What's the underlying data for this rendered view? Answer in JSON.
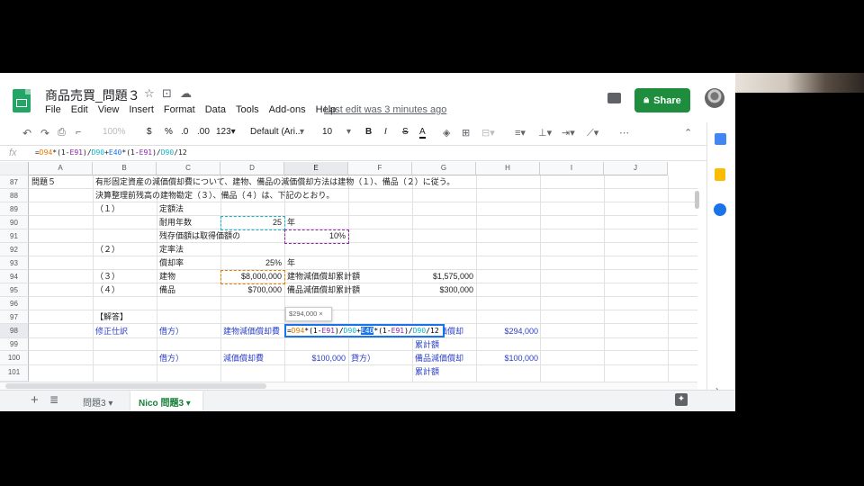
{
  "doc": {
    "title": "商品売買_問題３",
    "last_edit": "Last edit was 3 minutes ago",
    "share_label": "Share"
  },
  "menu": [
    "File",
    "Edit",
    "View",
    "Insert",
    "Format",
    "Data",
    "Tools",
    "Add-ons",
    "Help"
  ],
  "toolbar": {
    "zoom": "100%",
    "currency": "$",
    "percent": "%",
    "dec_less": ".0",
    "dec_more": ".00",
    "more_formats": "123▾",
    "font": "Default (Ari...",
    "font_size": "10",
    "bold": "B",
    "italic": "I",
    "strike": "S",
    "text_color": "A"
  },
  "formula_bar": {
    "fx": "fx",
    "formula_parts": [
      "=",
      "D94",
      "*(1-",
      "E91",
      ")/",
      "D90",
      "+",
      "E40",
      "*(1-",
      "E91",
      ")/",
      "D90",
      "/12"
    ]
  },
  "columns": [
    "A",
    "B",
    "C",
    "D",
    "E",
    "F",
    "G",
    "H",
    "I",
    "J"
  ],
  "row_numbers": [
    "87",
    "88",
    "89",
    "90",
    "91",
    "92",
    "93",
    "94",
    "95",
    "96",
    "97",
    "98",
    "99",
    "100",
    "101"
  ],
  "cells": {
    "a87": "問題５",
    "b87": "有形固定資産の減価償却費について、建物、備品の減価償却方法は建物（１）、備品（２）に従う。",
    "b88": "決算整理前残高の建物勘定（３）、備品（４）は、下記のとおり。",
    "b89": "（１）",
    "c89": "定額法",
    "c90": "耐用年数",
    "d90": "25",
    "e90": "年",
    "c91": "残存価額は取得価額の",
    "e91": "10%",
    "b92": "（２）",
    "c92": "定率法",
    "c93": "償却率",
    "d93": "25%",
    "e93": "年",
    "b94": "（３）",
    "c94": "建物",
    "d94": "$8,000,000",
    "e94": "建物減価償却累計額",
    "g94": "$1,575,000",
    "b95": "（４）",
    "c95": "備品",
    "d95": "$700,000",
    "e95": "備品減価償却累計額",
    "g95": "$300,000",
    "b97": "【解答】",
    "b98": "修正仕訳",
    "c98": "借方）",
    "d98": "建物減価償却費",
    "g98": "建物減価償却",
    "h98": "$294,000",
    "g99": "累計額",
    "c100": "借方）",
    "d100": "減価償却費",
    "e100": "$100,000",
    "f100": "貸方）",
    "g100": "備品減価償却",
    "h100": "$100,000",
    "g101": "累計額"
  },
  "edit_preview": "$294,000 ×",
  "sheet_tabs": [
    "問題3",
    "Nico 問題3"
  ],
  "colors": {
    "accent_green": "#1e8e3e",
    "ref_blue": "#1a73e8",
    "ref_orange": "#e67c00",
    "ref_purple": "#8e24aa",
    "ref_teal": "#12b5cb",
    "answer_blue": "#2a3fc9"
  }
}
